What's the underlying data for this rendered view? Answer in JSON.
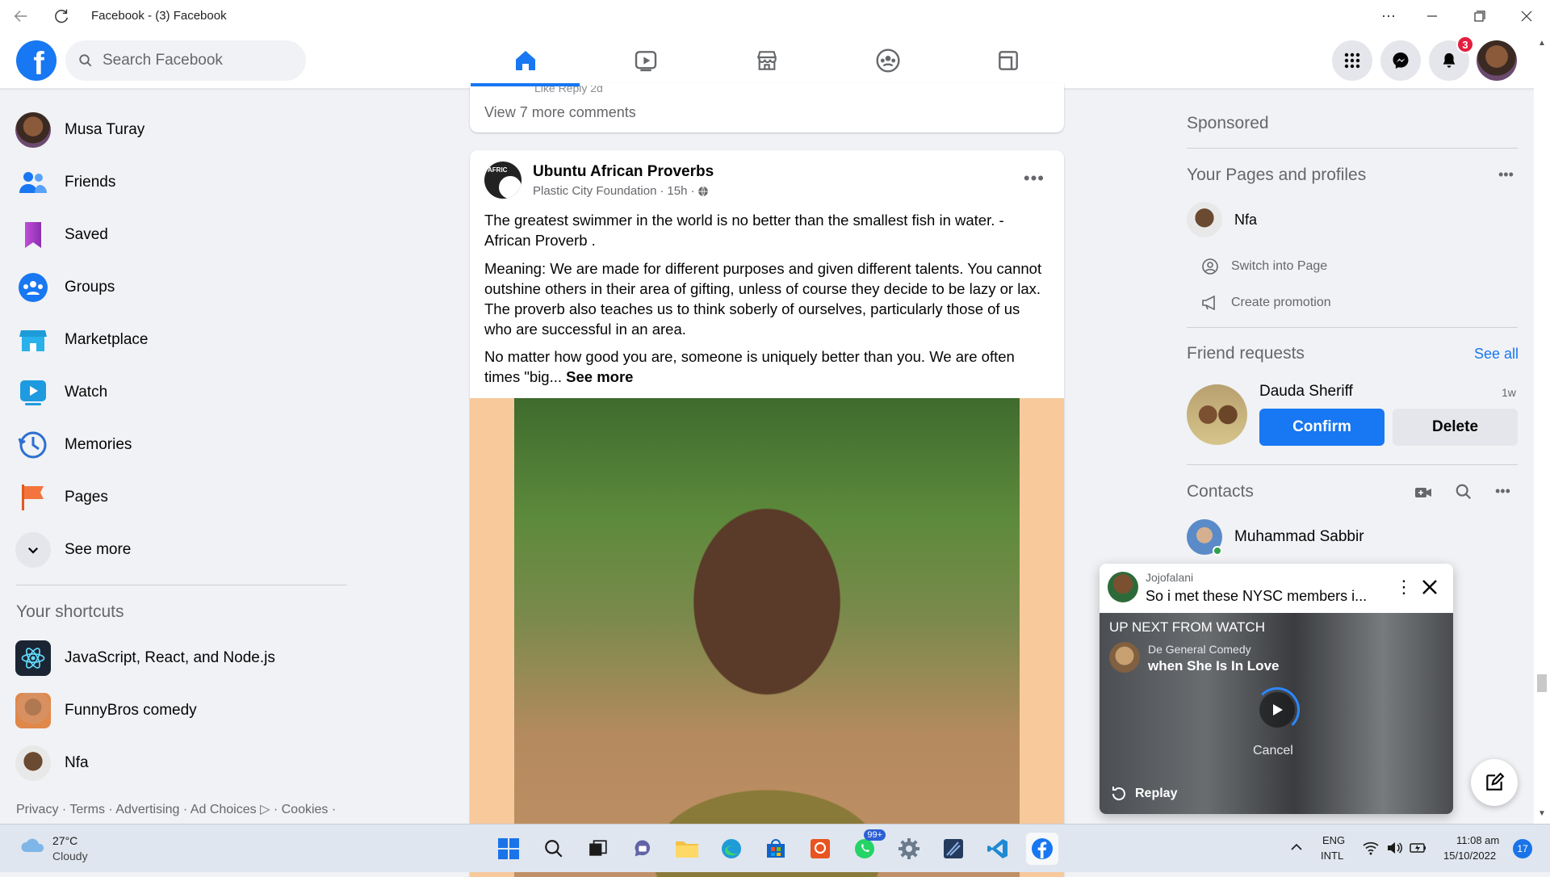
{
  "window": {
    "title": "Facebook - (3) Facebook"
  },
  "nav": {
    "search_placeholder": "Search Facebook",
    "tabs": [
      "home",
      "watch",
      "marketplace",
      "groups",
      "gaming"
    ],
    "notification_count": "3"
  },
  "sidebar": {
    "items": [
      {
        "label": "Musa Turay",
        "icon": "profile-avatar"
      },
      {
        "label": "Friends",
        "icon": "friends-icon"
      },
      {
        "label": "Saved",
        "icon": "saved-icon"
      },
      {
        "label": "Groups",
        "icon": "groups-icon"
      },
      {
        "label": "Marketplace",
        "icon": "marketplace-icon"
      },
      {
        "label": "Watch",
        "icon": "watch-icon"
      },
      {
        "label": "Memories",
        "icon": "memories-icon"
      },
      {
        "label": "Pages",
        "icon": "pages-icon"
      },
      {
        "label": "See more",
        "icon": "chevron-down-icon"
      }
    ],
    "shortcuts_title": "Your shortcuts",
    "shortcuts": [
      {
        "label": "JavaScript, React, and Node.js"
      },
      {
        "label": "FunnyBros comedy"
      },
      {
        "label": "Nfa"
      }
    ],
    "footer": {
      "privacy": "Privacy",
      "terms": "Terms",
      "advertising": "Advertising",
      "ad_choices": "Ad Choices",
      "cookies": "Cookies"
    }
  },
  "feed": {
    "prev": {
      "old_line": "Like     Reply     2d",
      "view_more": "View 7 more comments"
    },
    "post": {
      "author": "Ubuntu African Proverbs",
      "via": "Plastic City Foundation",
      "time": "15h",
      "p1": "The greatest swimmer in the world is no better than the smallest fish in water. - African Proverb .",
      "p2": "Meaning: We are made for different purposes and given different talents. You cannot outshine others in their area of gifting, unless of course they decide to be lazy or lax. The proverb also teaches us to think soberly of ourselves, particularly those of us who are successful in an area.",
      "p3": "No matter how good you are, someone is uniquely better than you. We are often times \"big...",
      "see_more": "See more"
    }
  },
  "right": {
    "sponsored": "Sponsored",
    "pages_title": "Your Pages and profiles",
    "page_name": "Nfa",
    "switch_label": "Switch into Page",
    "promo_label": "Create promotion",
    "friend_requests_title": "Friend requests",
    "see_all": "See all",
    "request_name": "Dauda Sheriff",
    "request_time": "1w",
    "confirm": "Confirm",
    "delete": "Delete",
    "contacts_title": "Contacts",
    "contact_name": "Muhammad Sabbir"
  },
  "popup": {
    "channel": "Jojofalani",
    "title": "So i met these NYSC members i...",
    "up_next": "UP NEXT FROM WATCH",
    "next_channel": "De General Comedy",
    "next_title": "when She Is In Love",
    "cancel": "Cancel",
    "replay": "Replay"
  },
  "taskbar": {
    "temp": "27°C",
    "weather": "Cloudy",
    "whatsapp_badge": "99+",
    "lang1": "ENG",
    "lang2": "INTL",
    "time": "11:08 am",
    "date": "15/10/2022",
    "notif_count": "17"
  },
  "colors": {
    "brand": "#1877f2",
    "badge": "#e41e3f",
    "page_bg": "#f0f2f5"
  }
}
